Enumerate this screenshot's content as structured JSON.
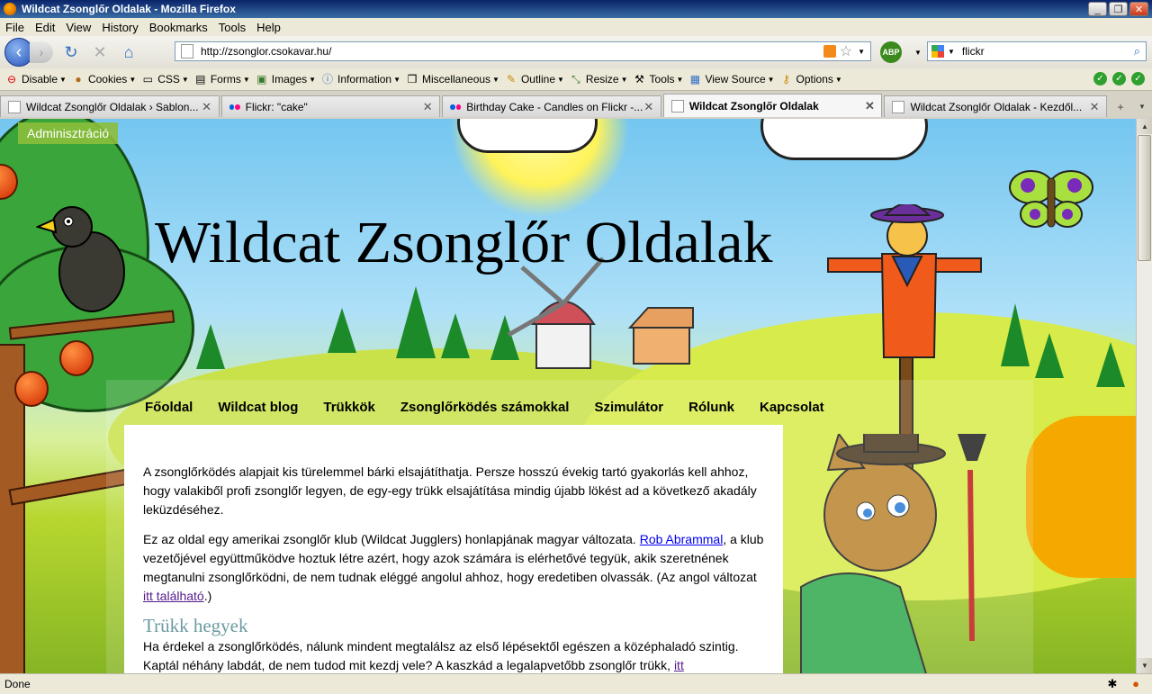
{
  "window": {
    "title": "Wildcat Zsonglőr Oldalak - Mozilla Firefox"
  },
  "menu": [
    "File",
    "Edit",
    "View",
    "History",
    "Bookmarks",
    "Tools",
    "Help"
  ],
  "nav": {
    "url": "http://zsonglor.csokavar.hu/",
    "search_value": "flickr",
    "abp_label": "ABP"
  },
  "devtoolbar": [
    {
      "label": "Disable",
      "icon": "disable-icon"
    },
    {
      "label": "Cookies",
      "icon": "cookie-icon"
    },
    {
      "label": "CSS",
      "icon": "css-icon"
    },
    {
      "label": "Forms",
      "icon": "forms-icon"
    },
    {
      "label": "Images",
      "icon": "images-icon"
    },
    {
      "label": "Information",
      "icon": "info-icon"
    },
    {
      "label": "Miscellaneous",
      "icon": "misc-icon"
    },
    {
      "label": "Outline",
      "icon": "outline-icon"
    },
    {
      "label": "Resize",
      "icon": "resize-icon"
    },
    {
      "label": "Tools",
      "icon": "tools-icon"
    },
    {
      "label": "View Source",
      "icon": "view-source-icon"
    },
    {
      "label": "Options",
      "icon": "options-icon"
    }
  ],
  "tabs": [
    {
      "label": "Wildcat Zsonglőr Oldalak › Sablon...",
      "icon": "page",
      "active": false
    },
    {
      "label": "Flickr: \"cake\"",
      "icon": "flickr",
      "active": false
    },
    {
      "label": "Birthday Cake - Candles on Flickr -...",
      "icon": "flickr",
      "active": false
    },
    {
      "label": "Wildcat Zsonglőr Oldalak",
      "icon": "page",
      "active": true
    },
    {
      "label": "Wildcat Zsonglőr Oldalak - Kezdől...",
      "icon": "page",
      "active": false
    }
  ],
  "page": {
    "admin_label": "Adminisztráció",
    "site_title": "Wildcat Zsonglőr Oldalak",
    "nav": [
      "Főoldal",
      "Wildcat blog",
      "Trükkök",
      "Zsonglőrködés számokkal",
      "Szimulátor",
      "Rólunk",
      "Kapcsolat"
    ],
    "p1": "A zsonglőrködés alapjait kis türelemmel bárki elsajátíthatja. Persze hosszú évekig tartó gyakorlás kell ahhoz, hogy valakiből profi zsonglőr legyen, de egy-egy trükk elsajátítása mindig újabb lökést ad a következő akadály leküzdéséhez.",
    "p2_before": "Ez az oldal egy amerikai zsonglőr klub (Wildcat Jugglers) honlapjának magyar változata. ",
    "p2_link": "Rob Abrammal",
    "p2_middle": ", a klub vezetőjével együttműködve hoztuk létre azért, hogy azok számára is elérhetővé tegyük, akik szeretnének megtanulni zsonglőrködni, de nem tudnak eléggé angolul ahhoz, hogy eredetiben olvassák. (Az angol változat ",
    "p2_link2": "itt található",
    "p2_after": ".)",
    "h2": "Trükk hegyek",
    "p3_before": "Ha érdekel a zsonglőrködés, nálunk mindent megtalálsz az első lépésektől egészen a középhaladó szintig. Kaptál néhány labdát, de nem tudod mit kezdj vele? A kaszkád a legalapvetőbb zsonglőr trükk, ",
    "p3_link": "itt"
  },
  "status": {
    "text": "Done"
  },
  "colors": {
    "title_bar": "#0a246a",
    "link": "#0000ee",
    "visited_link": "#551a8b",
    "heading": "#6a9aa0",
    "admin_bg": "#8cbe3c"
  }
}
